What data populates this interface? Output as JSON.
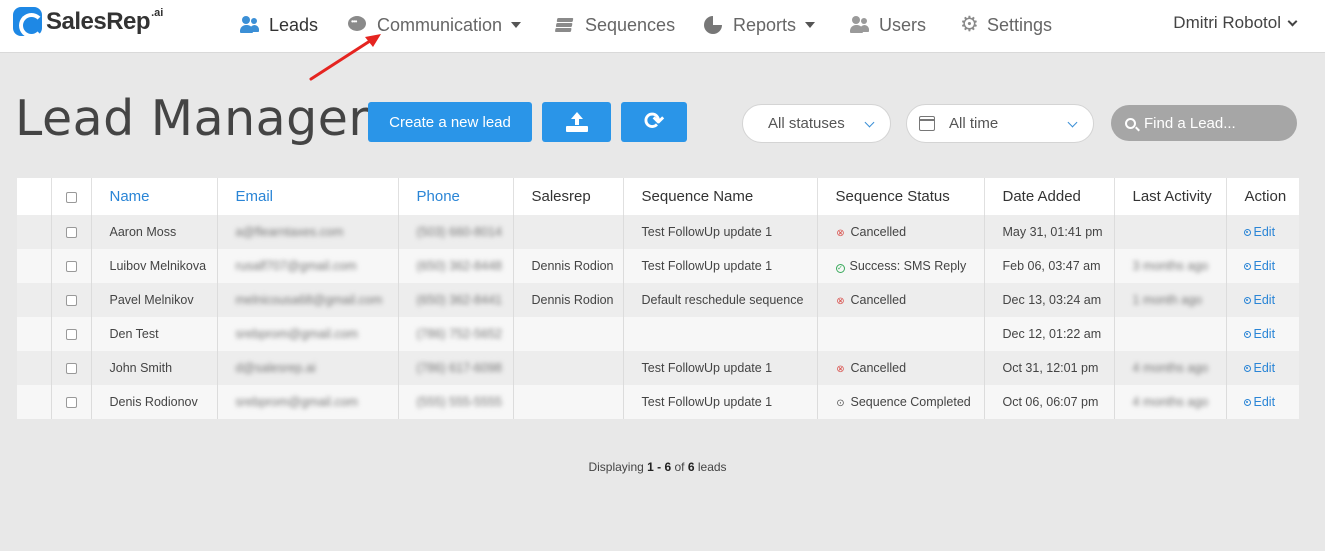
{
  "brand": {
    "name": "SalesRep",
    "suffix": ".ai"
  },
  "nav": [
    {
      "label": "Leads",
      "icon": "users-icon",
      "active": true
    },
    {
      "label": "Communication",
      "icon": "chat-icon",
      "dropdown": true
    },
    {
      "label": "Sequences",
      "icon": "layers-icon"
    },
    {
      "label": "Reports",
      "icon": "pie-chart-icon",
      "dropdown": true
    },
    {
      "label": "Users",
      "icon": "users-icon"
    },
    {
      "label": "Settings",
      "icon": "gear-icon"
    }
  ],
  "user": {
    "name": "Dmitri Robotol"
  },
  "page": {
    "title": "Lead Manager"
  },
  "toolbar": {
    "create_label": "Create a new lead",
    "upload_icon": "upload-icon",
    "refresh_icon": "refresh-icon",
    "status_filter": "All statuses",
    "time_filter": "All time",
    "search_placeholder": "Find a Lead..."
  },
  "table": {
    "headers": [
      "",
      "",
      "Name",
      "Email",
      "Phone",
      "Salesrep",
      "Sequence Name",
      "Sequence Status",
      "Date Added",
      "Last Activity",
      "Action"
    ],
    "rows": [
      {
        "name": "Aaron Moss",
        "email": "a@flearntaxes.com",
        "phone": "(503) 660-8014",
        "salesrep": "",
        "sequence": "Test FollowUp update 1",
        "status": "Cancelled",
        "status_type": "cancel",
        "date": "May 31, 01:41 pm",
        "activity": "",
        "action": "Edit"
      },
      {
        "name": "Luibov Melnikova",
        "email": "rusalf707@gmail.com",
        "phone": "(650) 362-8448",
        "salesrep": "Dennis Rodion",
        "sequence": "Test FollowUp update 1",
        "status": "Success: SMS Reply",
        "status_type": "ok",
        "date": "Feb 06, 03:47 am",
        "activity": "3 months ago",
        "action": "Edit"
      },
      {
        "name": "Pavel Melnikov",
        "email": "melnicousa68@gmail.com",
        "phone": "(650) 362-8441",
        "salesrep": "Dennis Rodion",
        "sequence": "Default reschedule sequence",
        "status": "Cancelled",
        "status_type": "cancel",
        "date": "Dec 13, 03:24 am",
        "activity": "1 month ago",
        "action": "Edit"
      },
      {
        "name": "Den Test",
        "email": "srebprom@gmail.com",
        "phone": "(786) 752-5652",
        "salesrep": "",
        "sequence": "",
        "status": "",
        "status_type": "",
        "date": "Dec 12, 01:22 am",
        "activity": "",
        "action": "Edit"
      },
      {
        "name": "John Smith",
        "email": "d@salesrep.ai",
        "phone": "(786) 617-6098",
        "salesrep": "",
        "sequence": "Test FollowUp update 1",
        "status": "Cancelled",
        "status_type": "cancel",
        "date": "Oct 31, 12:01 pm",
        "activity": "4 months ago",
        "action": "Edit"
      },
      {
        "name": "Denis Rodionov",
        "email": "srebprom@gmail.com",
        "phone": "(555) 555-5555",
        "salesrep": "",
        "sequence": "Test FollowUp update 1",
        "status": "Sequence Completed",
        "status_type": "done",
        "date": "Oct 06, 06:07 pm",
        "activity": "4 months ago",
        "action": "Edit"
      }
    ]
  },
  "footer": {
    "prefix": "Displaying ",
    "range": "1 - 6",
    "of": " of ",
    "total": "6",
    "suffix": " leads"
  },
  "colors": {
    "primary": "#2a95e8",
    "link": "#2a85d6",
    "cancel": "#d9534f",
    "success": "#3aaa5c",
    "annotation_arrow": "#e52420"
  }
}
